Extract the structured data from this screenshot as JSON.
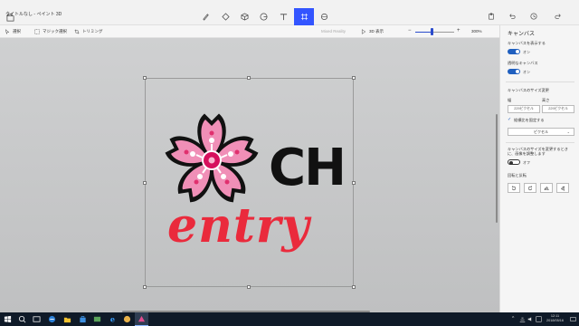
{
  "window": {
    "title": "タイトルなし - ペイント 3D"
  },
  "ribbon": {
    "tools": [
      {
        "name": "menu-icon"
      },
      {
        "name": "brushes-icon"
      },
      {
        "name": "2d-shapes-icon"
      },
      {
        "name": "3d-shapes-icon"
      },
      {
        "name": "stickers-icon"
      },
      {
        "name": "text-icon"
      },
      {
        "name": "effects-icon"
      },
      {
        "name": "canvas-icon"
      },
      {
        "name": "mixed-reality-icon"
      }
    ],
    "right": [
      {
        "name": "paste-icon"
      },
      {
        "name": "undo-icon"
      },
      {
        "name": "history-icon"
      },
      {
        "name": "redo-icon"
      }
    ]
  },
  "toolbar": {
    "select": "選択",
    "magic_select": "マジック選択",
    "crop": "トリミング",
    "mixed_reality": "Mixed Reality",
    "view3d": "3D 表示",
    "zoom": "300%",
    "zoom_level": 0.42
  },
  "canvas": {
    "ch": "CH",
    "entry": "entry",
    "colors": {
      "petal": "#f08fb7",
      "outline": "#111111",
      "center": "#d6105d",
      "entry": "#ea2a3c"
    }
  },
  "panel": {
    "title": "キャンバス",
    "show_canvas": "キャンバスを表示する",
    "show_on": "オン",
    "transparent": "透明なキャンバス",
    "transparent_on": "オン",
    "resize": "キャンバスのサイズ変更",
    "width_label": "幅",
    "height_label": "高さ",
    "width_value": "229ピクセル",
    "height_value": "229ピクセル",
    "lock_aspect": "縦横比を固定する",
    "unit": "ピクセル",
    "resize_image": "キャンバスのサイズを変更するときに、画像を調整します",
    "resize_image_state": "オフ",
    "rotate_flip": "回転と反転"
  },
  "taskbar": {
    "time": "12:11",
    "date": "2018/05/16"
  }
}
